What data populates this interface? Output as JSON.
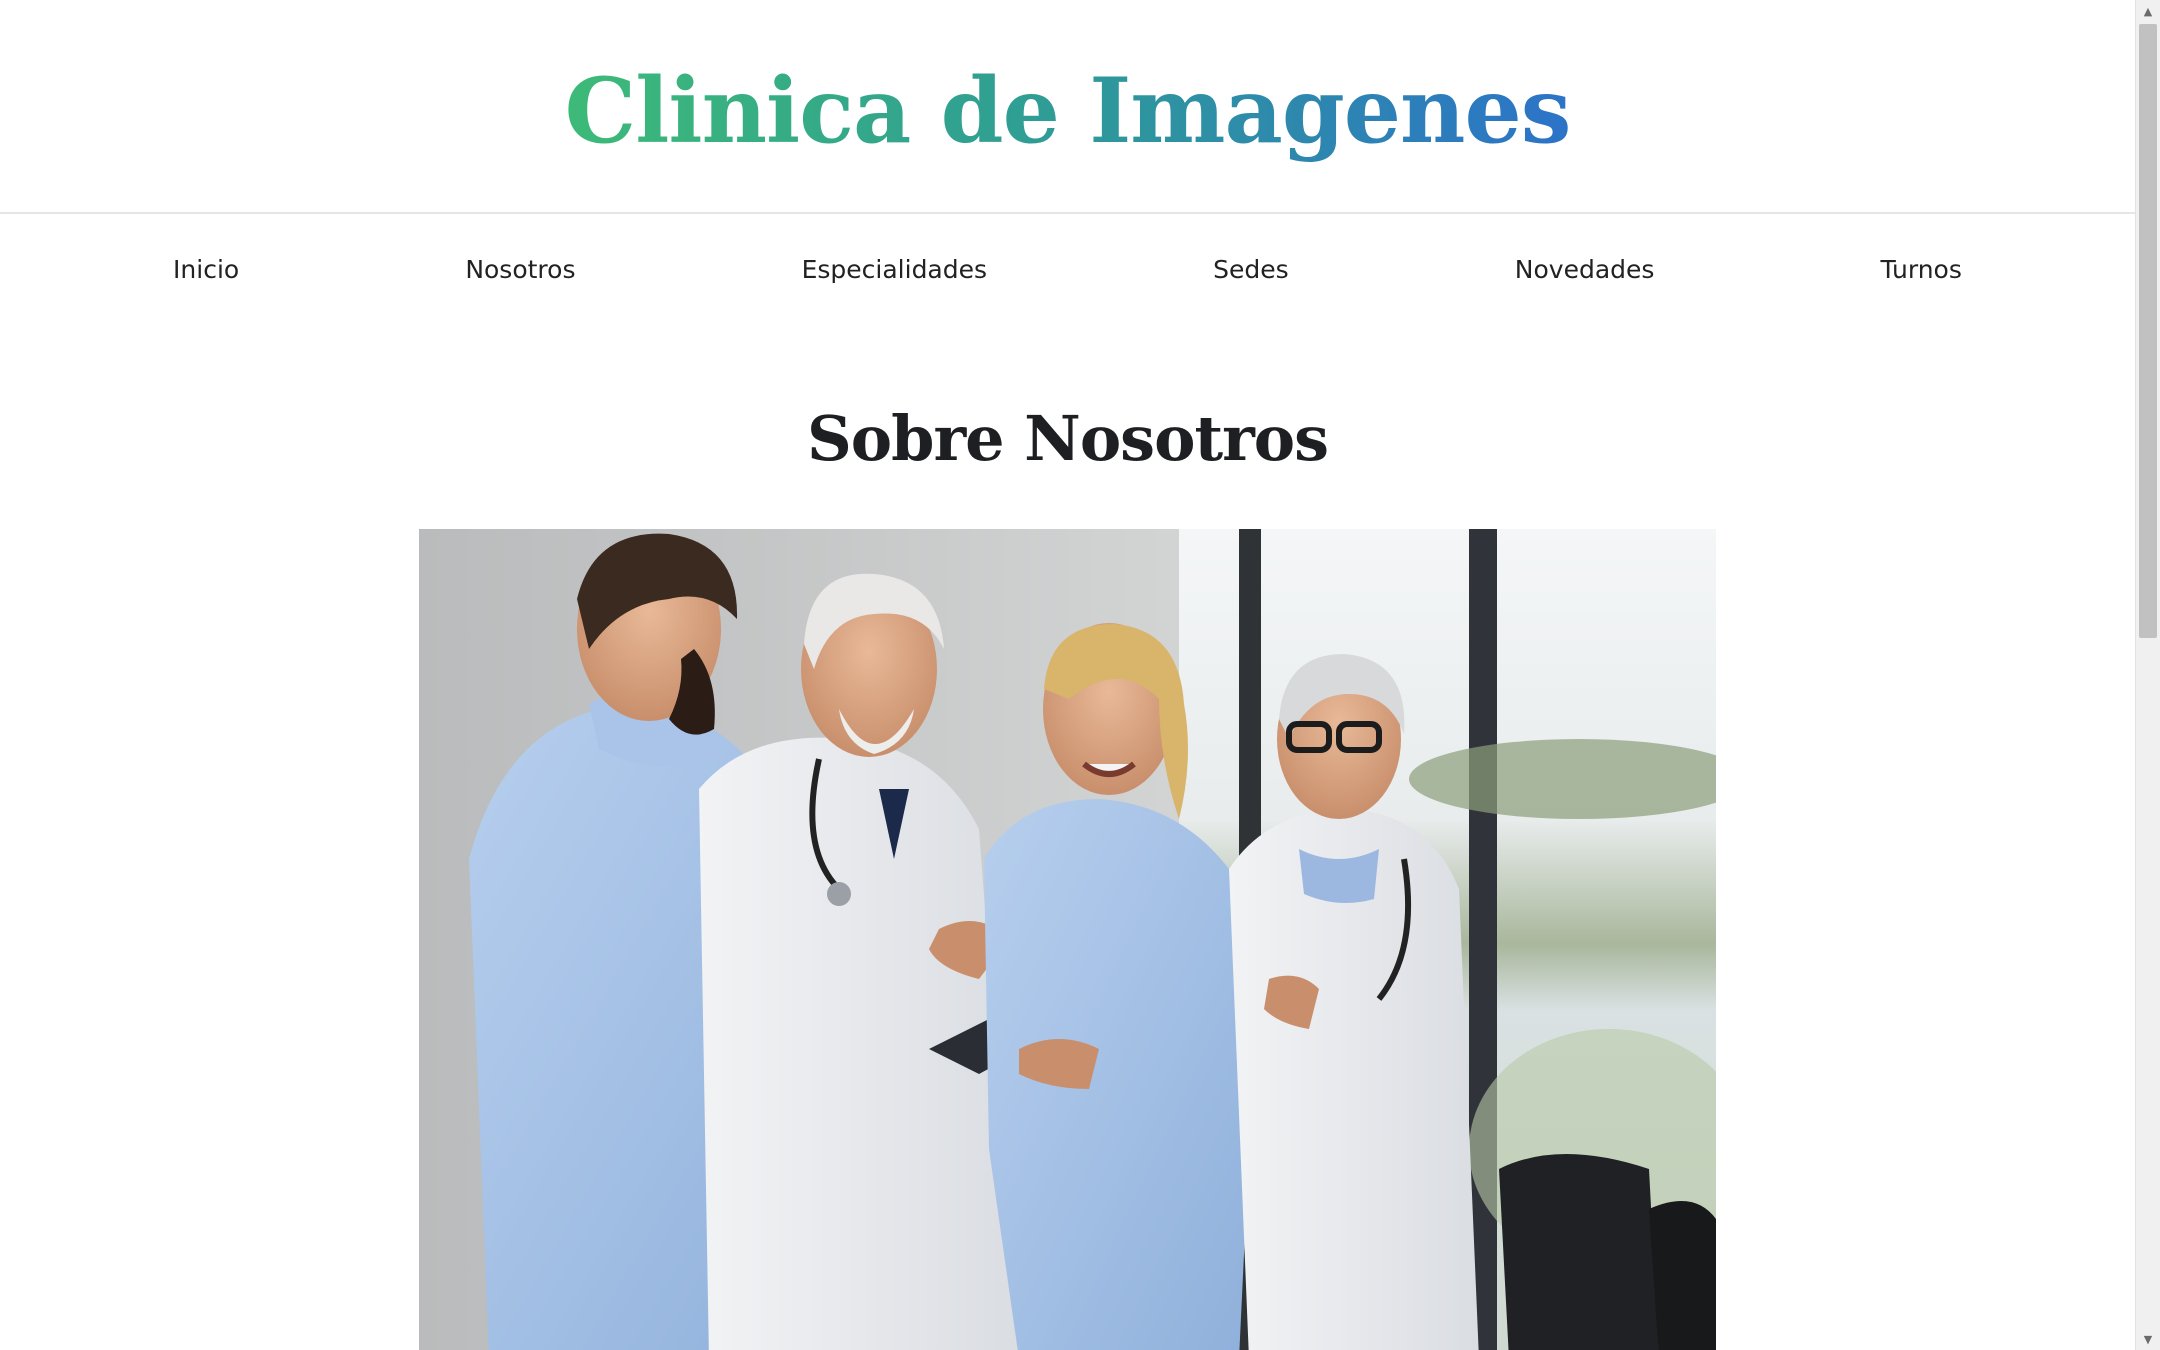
{
  "header": {
    "title": "Clinica de Imagenes",
    "gradient_start": "#3dba78",
    "gradient_end": "#2c73c8"
  },
  "nav": {
    "items": [
      {
        "label": "Inicio"
      },
      {
        "label": "Nosotros"
      },
      {
        "label": "Especialidades"
      },
      {
        "label": "Sedes"
      },
      {
        "label": "Novedades"
      },
      {
        "label": "Turnos"
      }
    ]
  },
  "main": {
    "section_title": "Sobre Nosotros",
    "photo_icon": "team-photo"
  },
  "colors": {
    "background": "#ffffff",
    "text": "#222222",
    "divider": "#e6e6e6"
  }
}
